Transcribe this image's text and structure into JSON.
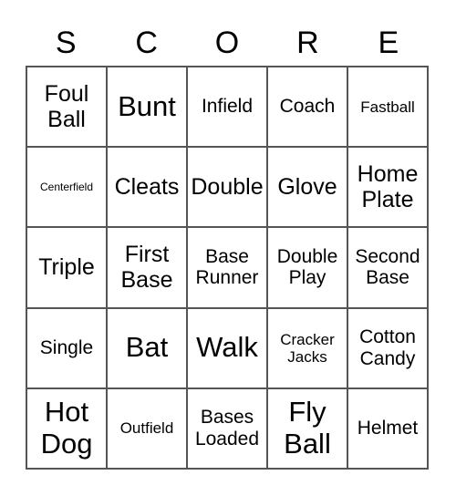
{
  "card": {
    "title_letters": [
      "S",
      "C",
      "O",
      "R",
      "E"
    ],
    "grid_size": "5x5",
    "colors": {
      "background": "#ffffff",
      "text": "#000000",
      "border": "#555555"
    },
    "rows": [
      [
        {
          "label": "Foul\nBall",
          "size": "fs-l"
        },
        {
          "label": "Bunt",
          "size": "fs-xl"
        },
        {
          "label": "Infield",
          "size": "fs-m"
        },
        {
          "label": "Coach",
          "size": "fs-m"
        },
        {
          "label": "Fastball",
          "size": "fs-s"
        }
      ],
      [
        {
          "label": "Centerfield",
          "size": "fs-xs"
        },
        {
          "label": "Cleats",
          "size": "fs-l"
        },
        {
          "label": "Double",
          "size": "fs-l"
        },
        {
          "label": "Glove",
          "size": "fs-l"
        },
        {
          "label": "Home\nPlate",
          "size": "fs-l"
        }
      ],
      [
        {
          "label": "Triple",
          "size": "fs-l"
        },
        {
          "label": "First\nBase",
          "size": "fs-l"
        },
        {
          "label": "Base\nRunner",
          "size": "fs-m"
        },
        {
          "label": "Double\nPlay",
          "size": "fs-m"
        },
        {
          "label": "Second\nBase",
          "size": "fs-m"
        }
      ],
      [
        {
          "label": "Single",
          "size": "fs-m"
        },
        {
          "label": "Bat",
          "size": "fs-xl"
        },
        {
          "label": "Walk",
          "size": "fs-xl"
        },
        {
          "label": "Cracker\nJacks",
          "size": "fs-s"
        },
        {
          "label": "Cotton\nCandy",
          "size": "fs-m"
        }
      ],
      [
        {
          "label": "Hot\nDog",
          "size": "fs-xl"
        },
        {
          "label": "Outfield",
          "size": "fs-s"
        },
        {
          "label": "Bases\nLoaded",
          "size": "fs-m"
        },
        {
          "label": "Fly\nBall",
          "size": "fs-xl"
        },
        {
          "label": "Helmet",
          "size": "fs-m"
        }
      ]
    ]
  }
}
